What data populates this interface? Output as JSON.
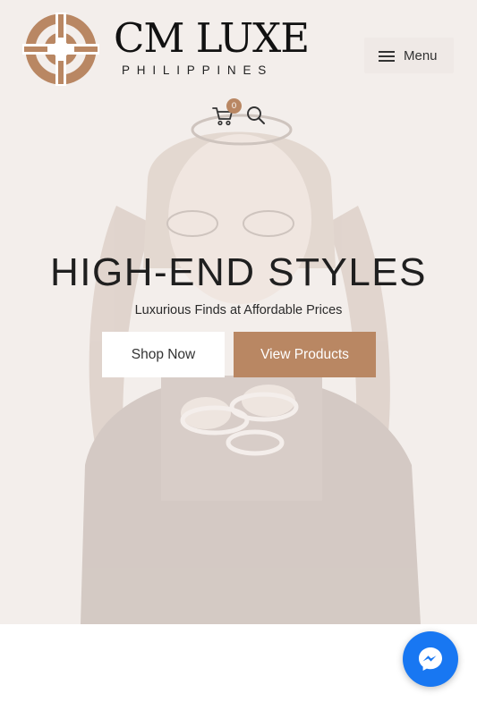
{
  "brand": {
    "name": "CM LUXE",
    "subtitle": "PHILIPPINES",
    "accent_color": "#b98763"
  },
  "header": {
    "menu_label": "Menu",
    "cart_count": "0",
    "icons": [
      "hamburger-icon",
      "cart-icon",
      "search-icon"
    ]
  },
  "hero": {
    "title": "HIGH-END STYLES",
    "subtitle": "Luxurious Finds at Affordable Prices",
    "primary_button": "Shop Now",
    "secondary_button": "View Products"
  },
  "chat": {
    "icon": "messenger-icon",
    "color": "#1877f2"
  }
}
